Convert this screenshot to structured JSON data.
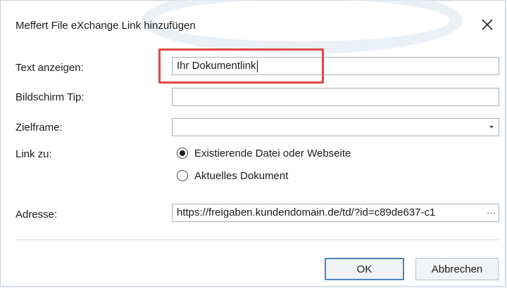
{
  "dialog": {
    "title": "Meffert File eXchange Link hinzufügen",
    "close_symbol": "✕"
  },
  "form": {
    "display_text_label": "Text anzeigen:",
    "display_text_value": "Ihr Dokumentlink",
    "screen_tip_label": "Bildschirm Tip:",
    "screen_tip_value": "",
    "target_frame_label": "Zielframe:",
    "target_frame_value": "",
    "link_to_label": "Link zu:",
    "link_options": [
      {
        "label": "Existierende Datei oder Webseite",
        "checked": true
      },
      {
        "label": "Aktuelles Dokument",
        "checked": false
      }
    ],
    "address_label": "Adresse:",
    "address_value": "https://freigaben.kundendomain.de/td/?id=c89de637-c1",
    "address_more": "···"
  },
  "buttons": {
    "ok_label": "OK",
    "cancel_label": "Abbrechen"
  },
  "colors": {
    "highlight": "#e24646",
    "default_button_border": "#4a86c8"
  },
  "icons": {
    "close": "close-icon",
    "dropdown": "chevron-down-icon"
  }
}
